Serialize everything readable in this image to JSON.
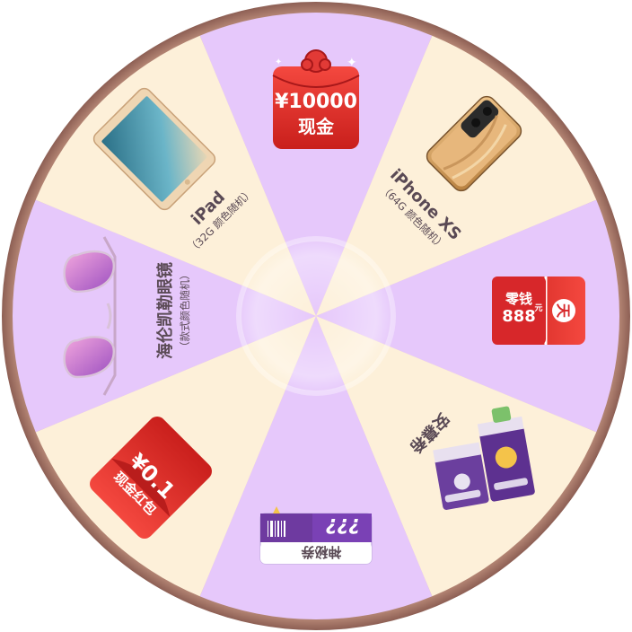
{
  "wheel": {
    "colors": {
      "rim": "#9c6c5f",
      "rim_light": "#e7c9b6",
      "sector_cream": "#fdf0d9",
      "sector_purple": "#e6c8fb",
      "text": "#5a4a55",
      "red": "#e43832",
      "purple_dark": "#6e3aa0"
    },
    "prizes": [
      {
        "id": "cash",
        "icon": "red-packet-icon",
        "amount": "¥10000",
        "label": "现金"
      },
      {
        "id": "iphone",
        "icon": "iphone-icon",
        "title": "iPhone XS",
        "sub": "（64G 颜色随机）"
      },
      {
        "id": "coupon888",
        "icon": "coupon-icon",
        "amount": "888",
        "unit": "元",
        "label": "零钱",
        "stamp": "天"
      },
      {
        "id": "milk",
        "icon": "milk-carton-icon",
        "title": "安慕希"
      },
      {
        "id": "mystery",
        "icon": "ticket-icon",
        "title": "神秘券",
        "mark": "???"
      },
      {
        "id": "redpacket",
        "icon": "red-packet-icon",
        "amount": "¥0.1",
        "label": "现金红包"
      },
      {
        "id": "sunglasses",
        "icon": "sunglasses-icon",
        "title": "海伦凯勒眼镜",
        "sub": "（款式颜色随机）"
      },
      {
        "id": "ipad",
        "icon": "ipad-icon",
        "title": "iPad",
        "sub": "（32G 颜色随机）"
      }
    ]
  }
}
